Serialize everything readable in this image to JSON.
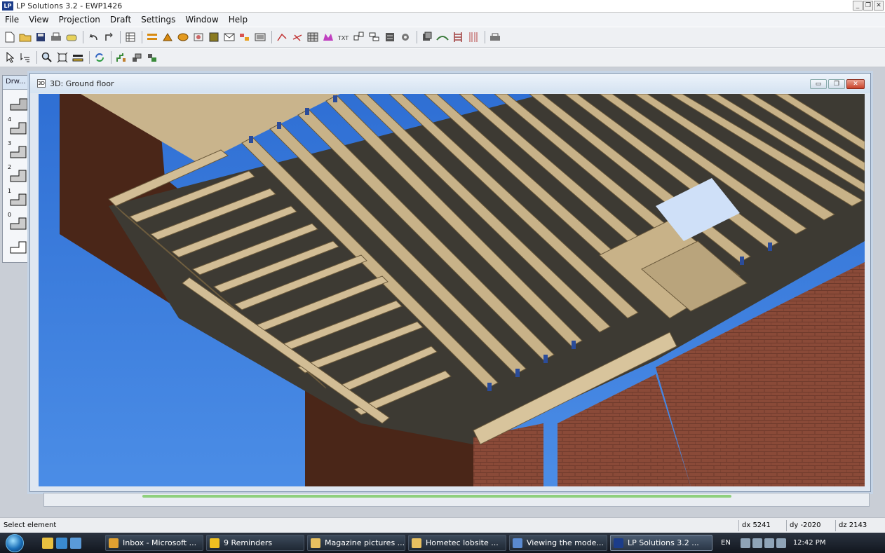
{
  "window": {
    "app_logo": "LP",
    "title": "LP Solutions 3.2 - EWP1426",
    "controls": [
      "_",
      "❐",
      "✕"
    ]
  },
  "menu": [
    "File",
    "View",
    "Projection",
    "Draft",
    "Settings",
    "Window",
    "Help"
  ],
  "toolbar1": {
    "icons": [
      "new-file-icon",
      "open-folder-icon",
      "save-icon",
      "print-icon",
      "print-preview-icon",
      "undo-icon",
      "redo-icon",
      "table-icon",
      "beam-icon",
      "joist-icon",
      "hanger-icon",
      "rim-icon",
      "wall-icon",
      "envelope-icon",
      "roof-icon",
      "panel-icon",
      "line-red-icon",
      "line-angle-icon",
      "grid-icon",
      "magenta-shape-icon",
      "text-icon",
      "dimension-icon",
      "layers-icon",
      "gear-icon",
      "stack-icon",
      "bridge-icon",
      "ladder-icon",
      "column-icon",
      "print-layout-icon"
    ]
  },
  "toolbar2": {
    "icons": [
      "select-pointer-icon",
      "select-filter-icon",
      "zoom-icon",
      "zoom-extents-icon",
      "pan-icon",
      "rotate-icon",
      "floor-stair-icon",
      "floor-2-icon",
      "floor-3-icon"
    ]
  },
  "draw_panel": {
    "title": "Drw...",
    "floors": [
      {
        "num": ""
      },
      {
        "num": "4"
      },
      {
        "num": "3"
      },
      {
        "num": "2"
      },
      {
        "num": "1"
      },
      {
        "num": "0"
      },
      {
        "num": ""
      }
    ]
  },
  "view_window": {
    "icon_label": "3D",
    "title": "3D: Ground floor",
    "controls": [
      "▭",
      "❐",
      "✕"
    ]
  },
  "status": {
    "message": "Select element",
    "dx": "dx 5241",
    "dy": "dy -2020",
    "dz": "dz 2143"
  },
  "taskbar": {
    "items": [
      {
        "label": "Inbox - Microsoft ...",
        "color": "#e0a030",
        "active": false
      },
      {
        "label": "9 Reminders",
        "color": "#f0c020",
        "active": false
      },
      {
        "label": "Magazine pictures ...",
        "color": "#e8c060",
        "active": false
      },
      {
        "label": "Hometec lobsite ...",
        "color": "#e8c060",
        "active": false
      },
      {
        "label": "Viewing the mode...",
        "color": "#5a8ad0",
        "active": false
      },
      {
        "label": "LP Solutions 3.2 ...",
        "color": "#1c3d8a",
        "active": true
      }
    ],
    "lang": "EN",
    "clock": "12:42 PM"
  }
}
